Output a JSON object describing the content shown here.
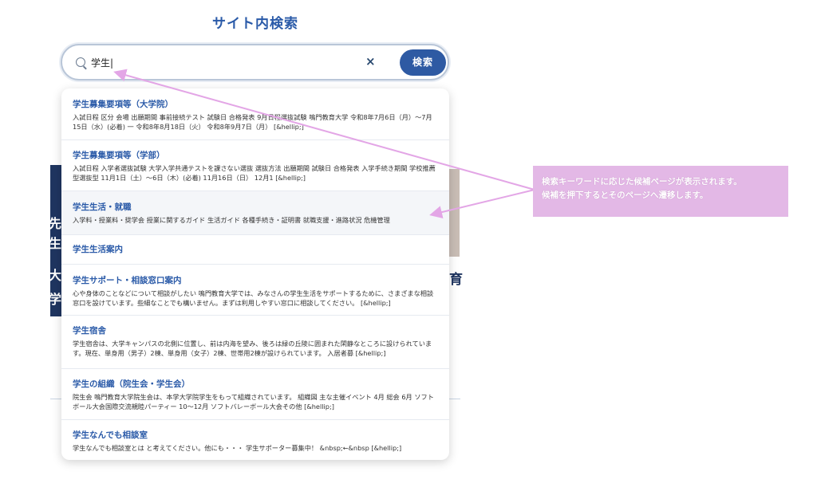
{
  "background": {
    "left_glyphs": [
      "先",
      "生",
      "大",
      "学"
    ],
    "right_glyph": "育"
  },
  "page": {
    "title": "サイト内検索"
  },
  "search": {
    "value": "学生|",
    "clear_icon": "close-icon",
    "clear_label": "×",
    "button_label": "検索"
  },
  "suggestions": [
    {
      "title": "学生募集要項等（大学院）",
      "snippet": "入試日程 区分 会場 出願期間 事前接続テスト 試験日 合格発表 9月日程選抜試験 鳴門教育大学 令和8年7月6日（月）〜7月15日（水）(必着) 一 令和8年8月18日（火） 令和8年9月7日（月） [&hellip;]"
    },
    {
      "title": "学生募集要項等（学部）",
      "snippet": "入試日程 入学者選抜試験 大学入学共通テストを課さない選抜 選抜方法 出願期間 試験日 合格発表 入学手続き期間 学校推薦型選抜型 11月1日（土）〜6日（木）(必着) 11月16日（日） 12月1 [&hellip;]"
    },
    {
      "title": "学生生活・就職",
      "snippet": "入学料・授業料・奨学会 授業に関するガイド 生活ガイド 各種手続き・証明書 就職支援・進路状況 危機管理"
    },
    {
      "title": "学生生活案内",
      "snippet": ""
    },
    {
      "title": "学生サポート・相談窓口案内",
      "snippet": "心や身体のことなどについて相談がしたい 鳴門教育大学では、みなさんの学生生活をサポートするために、さまざまな相談窓口を設けています。些細なことでも構いません。まずは利用しやすい窓口に相談してください。 [&hellip;]"
    },
    {
      "title": "学生宿舎",
      "snippet": "学生宿舎は、大学キャンパスの北側に位置し、前は内海を望み、後ろは緑の丘陵に囲まれた閑静なところに設けられています。現在、単身用（男子）2棟、単身用（女子）2棟、世帯用2棟が設けられています。 入居者募 [&hellip;]"
    },
    {
      "title": "学生の組織（院生会・学生会）",
      "snippet": "院生会 鳴門教育大学院生会は、本学大学院学生をもって組織されています。 組織図 主な主催イベント 4月 総会 6月 ソフトボール大会国際交流親睦パーティー 10〜12月 ソフトバレーボール大会その他 [&hellip;]"
    },
    {
      "title": "学生なんでも相談室",
      "snippet": "学生なんでも相談室とは と考えてください。他にも・・・ 学生サポーター募集中！ &nbsp;←&nbsp [&hellip;]"
    }
  ],
  "callout": {
    "text": "検索キーワードに応じた候補ページが表示されます。\n候補を押下するとそのページへ遷移します。"
  },
  "colors": {
    "accent": "#2e5aa3",
    "title": "#2a5aa8",
    "callout_bg": "#e3b8e6",
    "arrow": "#e3a6e6"
  }
}
